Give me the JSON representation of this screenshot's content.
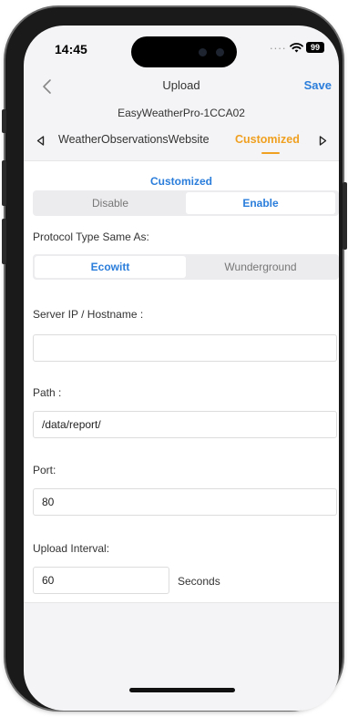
{
  "status": {
    "time": "14:45",
    "signal_dots": "....",
    "battery": "99"
  },
  "nav": {
    "title": "Upload",
    "save_label": "Save"
  },
  "device_name": "EasyWeatherPro-1CCA02",
  "tabs": [
    {
      "label": "WeatherObservationsWebsite",
      "active": false
    },
    {
      "label": "Customized",
      "active": true
    }
  ],
  "section_title": "Customized",
  "toggle": {
    "options": [
      "Disable",
      "Enable"
    ],
    "selected": "Enable"
  },
  "protocol": {
    "label": "Protocol Type Same As:",
    "options": [
      "Ecowitt",
      "Wunderground"
    ],
    "selected": "Ecowitt"
  },
  "fields": {
    "server": {
      "label": "Server IP / Hostname :",
      "value": ""
    },
    "path": {
      "label": "Path :",
      "value": "/data/report/"
    },
    "port": {
      "label": "Port:",
      "value": "80"
    },
    "interval": {
      "label": "Upload Interval:",
      "value": "60",
      "unit": "Seconds"
    }
  },
  "colors": {
    "accent_blue": "#2a7ddb",
    "accent_orange": "#f0a020",
    "background": "#f4f4f6"
  }
}
